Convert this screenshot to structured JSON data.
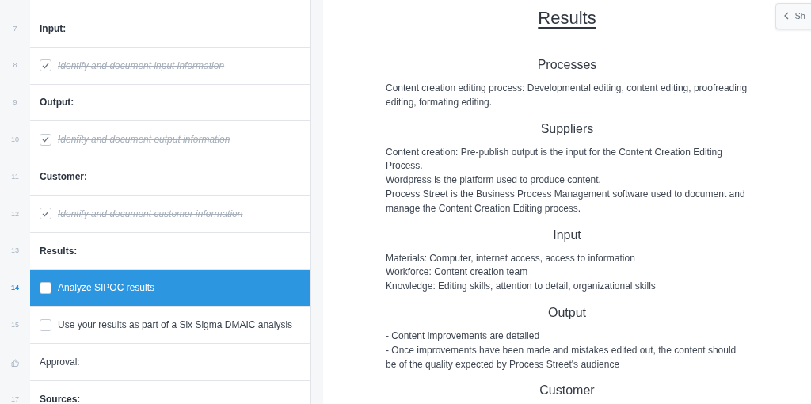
{
  "checklist": [
    {
      "kind": "blank"
    },
    {
      "kind": "heading",
      "number": "7",
      "label": "Input:"
    },
    {
      "kind": "task",
      "number": "8",
      "label": "Identify and document input information",
      "checked": true,
      "selected": false
    },
    {
      "kind": "heading",
      "number": "9",
      "label": "Output:"
    },
    {
      "kind": "task",
      "number": "10",
      "label": "Idenfity and document output information",
      "checked": true,
      "selected": false
    },
    {
      "kind": "heading",
      "number": "11",
      "label": "Customer:"
    },
    {
      "kind": "task",
      "number": "12",
      "label": "Identify and document customer information",
      "checked": true,
      "selected": false
    },
    {
      "kind": "heading",
      "number": "13",
      "label": "Results:"
    },
    {
      "kind": "task",
      "number": "14",
      "label": "Analyze SIPOC results",
      "checked": false,
      "selected": true
    },
    {
      "kind": "task",
      "number": "15",
      "label": "Use your results as part of a Six Sigma DMAIC analysis",
      "checked": false,
      "selected": false
    },
    {
      "kind": "approval",
      "label": "Approval:"
    },
    {
      "kind": "heading",
      "number": "17",
      "label": "Sources:"
    }
  ],
  "show_button": {
    "label": "Sh"
  },
  "document": {
    "title": "Results",
    "sections": [
      {
        "heading": "Processes",
        "paragraphs": [
          "Content creation editing process: Developmental editing, content editing, proofreading editing, formating editing."
        ]
      },
      {
        "heading": "Suppliers",
        "paragraphs": [
          "Content creation: Pre-publish output is the input for the Content Creation Editing Process.",
          "Wordpress is the platform used to produce content.",
          "Process Street is the Business Process Management software used to document and manage the Content Creation Editing process."
        ]
      },
      {
        "heading": "Input",
        "paragraphs": [
          "Materials: Computer, internet access, access to information",
          "Workforce: Content creation team",
          "Knowledge: Editing skills, attention to detail, organizational skills"
        ]
      },
      {
        "heading": "Output",
        "paragraphs": [
          "- Content improvements are detailed",
          "- Once improvements have been made and mistakes edited out, the content should be of the quality expected by Process Street's audience"
        ]
      },
      {
        "heading": "Customer"
      }
    ]
  }
}
